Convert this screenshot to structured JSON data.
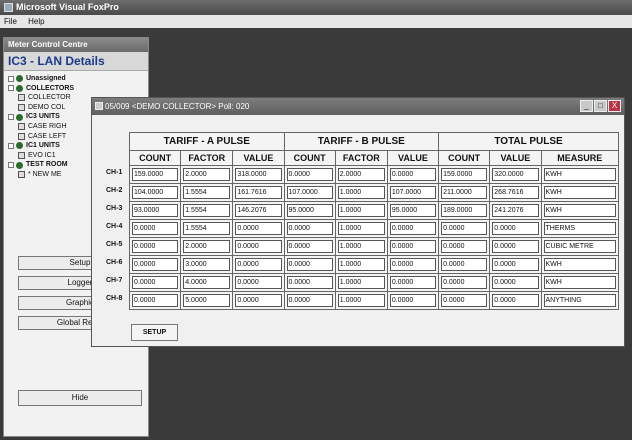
{
  "app": {
    "title": "Microsoft Visual FoxPro",
    "menu": [
      "File",
      "Help"
    ]
  },
  "left_panel": {
    "title": "Meter Control Centre",
    "heading": "IC3 - LAN Details",
    "tree": [
      {
        "label": "Unassigned",
        "level": 0,
        "kind": "node",
        "bold": true
      },
      {
        "label": "COLLECTORS",
        "level": 0,
        "kind": "node",
        "bold": true
      },
      {
        "label": "COLLECTOR",
        "level": 1,
        "kind": "leaf",
        "bold": false
      },
      {
        "label": "DEMO COL",
        "level": 1,
        "kind": "leaf",
        "bold": false
      },
      {
        "label": "IC3 UNITS",
        "level": 0,
        "kind": "node",
        "bold": true
      },
      {
        "label": "CASE RIGH",
        "level": 1,
        "kind": "leaf",
        "bold": false
      },
      {
        "label": "CASE LEFT",
        "level": 1,
        "kind": "leaf",
        "bold": false
      },
      {
        "label": "IC1 UNITS",
        "level": 0,
        "kind": "node",
        "bold": true
      },
      {
        "label": "EVO IC1",
        "level": 1,
        "kind": "leaf",
        "bold": false
      },
      {
        "label": "TEST ROOM",
        "level": 0,
        "kind": "node",
        "bold": true
      },
      {
        "label": "* NEW ME",
        "level": 1,
        "kind": "leaf",
        "bold": false
      }
    ],
    "buttons": [
      "Setup",
      "Logger",
      "Graphic",
      "Global Reset"
    ],
    "hide_label": "Hide"
  },
  "dialog": {
    "title": "05/009 <DEMO COLLECTOR> Poll: 020",
    "window_buttons": [
      "_",
      "□",
      "X"
    ],
    "groups": [
      "TARIFF - A PULSE",
      "TARIFF - B PULSE",
      "TOTAL PULSE"
    ],
    "columns": [
      "COUNT",
      "FACTOR",
      "VALUE",
      "COUNT",
      "FACTOR",
      "VALUE",
      "COUNT",
      "VALUE",
      "MEASURE"
    ],
    "rows": [
      {
        "label": "CH-1",
        "cells": [
          "159.0000",
          "2.0000",
          "318.0000",
          "0.0000",
          "2.0000",
          "0.0000",
          "159.0000",
          "320.0000",
          "KWH"
        ]
      },
      {
        "label": "CH-2",
        "cells": [
          "104.0000",
          "1.5554",
          "161.7616",
          "107.0000",
          "1.0000",
          "107.0000",
          "211.0000",
          "268.7616",
          "KWH"
        ]
      },
      {
        "label": "CH-3",
        "cells": [
          "93.0000",
          "1.5554",
          "146.2076",
          "95.0000",
          "1.0000",
          "95.0000",
          "189.0000",
          "241.2076",
          "KWH"
        ]
      },
      {
        "label": "CH-4",
        "cells": [
          "0.0000",
          "1.5554",
          "0.0000",
          "0.0000",
          "1.0000",
          "0.0000",
          "0.0000",
          "0.0000",
          "THERMS"
        ]
      },
      {
        "label": "CH-5",
        "cells": [
          "0.0000",
          "2.0000",
          "0.0000",
          "0.0000",
          "1.0000",
          "0.0000",
          "0.0000",
          "0.0000",
          "CUBIC METRE"
        ]
      },
      {
        "label": "CH-6",
        "cells": [
          "0.0000",
          "3.0000",
          "0.0000",
          "0.0000",
          "1.0000",
          "0.0000",
          "0.0000",
          "0.0000",
          "KWH"
        ]
      },
      {
        "label": "CH-7",
        "cells": [
          "0.0000",
          "4.0000",
          "0.0000",
          "0.0000",
          "1.0000",
          "0.0000",
          "0.0000",
          "0.0000",
          "KWH"
        ]
      },
      {
        "label": "CH-8",
        "cells": [
          "0.0000",
          "5.0000",
          "0.0000",
          "0.0000",
          "1.0000",
          "0.0000",
          "0.0000",
          "0.0000",
          "ANYTHING"
        ]
      }
    ],
    "setup_label": "SETUP"
  }
}
